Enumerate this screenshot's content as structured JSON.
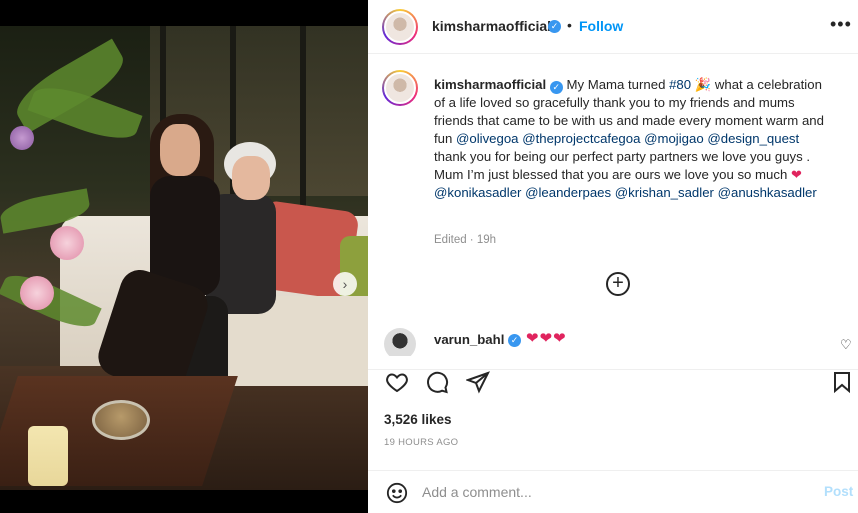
{
  "post": {
    "username": "kimsharmaofficial",
    "follow_label": "Follow",
    "separator": "•",
    "more_label": "•••"
  },
  "caption": {
    "username": "kimsharmaofficial",
    "part1": " My Mama turned ",
    "hashtag": "#80",
    "emoji1": " 🎉",
    "part2": " what a celebration of a life loved so gracefully thank you to my friends and mums friends that came to be with us and made every moment warm and fun ",
    "mention1": "@olivegoa",
    "mention2": "@theprojectcafegoa",
    "mention3": "@mojigao",
    "mention4": "@design_quest",
    "part3": " thank you for being our perfect party partners we love you guys . Mum I’m just blessed that you are ours we love you so much ",
    "heart": "❤",
    "mention5": "@konikasadler",
    "mention6": "@leanderpaes",
    "mention7": "@krishan_sadler",
    "mention8": "@anushkasadler",
    "edited": "Edited · 19h",
    "load_more": "+"
  },
  "comment": {
    "username": "varun_bahl",
    "text": "❤❤❤",
    "like_icon": "heart-outline-icon"
  },
  "stats": {
    "likes": "3,526 likes",
    "time": "19 HOURS AGO"
  },
  "composer": {
    "placeholder": "Add a comment...",
    "post_label": "Post"
  },
  "carousel": {
    "count": 9,
    "active": 0,
    "next_label": "›"
  },
  "colors": {
    "accent": "#0095f6",
    "verified": "#3897f0",
    "mention": "#00376b",
    "heart": "#e0245e"
  }
}
